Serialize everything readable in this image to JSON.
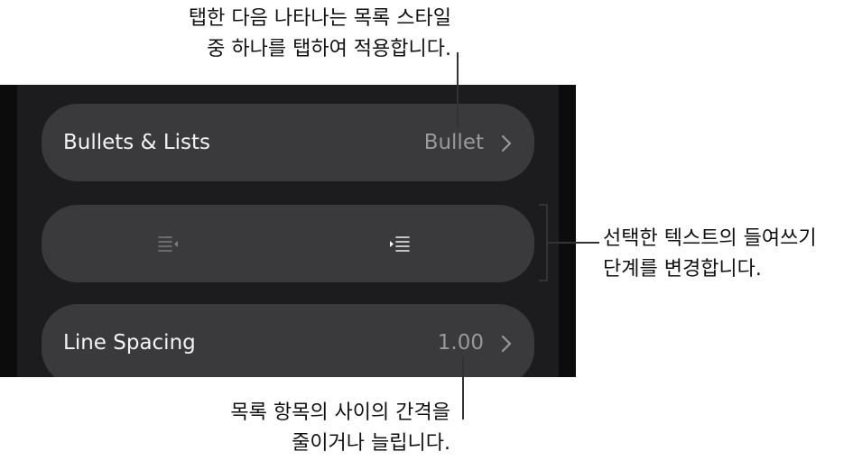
{
  "callouts": {
    "top": [
      "탭한 다음 나타나는 목록 스타일",
      "중 하나를 탭하여 적용합니다."
    ],
    "right": [
      "선택한 텍스트의 들여쓰기",
      "단계를 변경합니다."
    ],
    "bottom": [
      "목록 항목의 사이의 간격을",
      "줄이거나 늘립니다."
    ]
  },
  "rows": {
    "bullets": {
      "label": "Bullets & Lists",
      "value": "Bullet"
    },
    "indent": {
      "decrease_icon": "decrease-indent-icon",
      "increase_icon": "increase-indent-icon"
    },
    "spacing": {
      "label": "Line Spacing",
      "value": "1.00"
    }
  },
  "colors": {
    "panel": "#1c1c1e",
    "row": "#3a3a3c",
    "label": "#f2f2f7",
    "value": "#98989d",
    "leader": "#333333"
  }
}
